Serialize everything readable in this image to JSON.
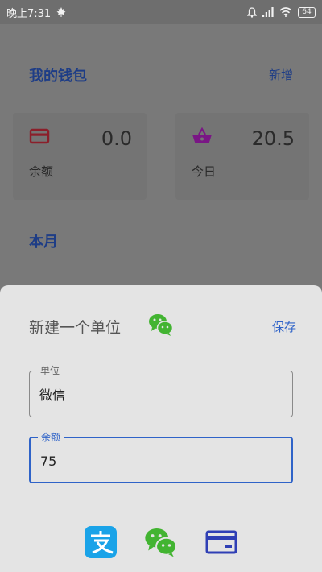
{
  "status_bar": {
    "time": "晚上7:31",
    "battery": "64"
  },
  "wallet": {
    "title": "我的钱包",
    "add_label": "新增",
    "cards": [
      {
        "value": "0.0",
        "label": "余额",
        "icon": "credit-card-icon",
        "icon_color": "#8b1f2a"
      },
      {
        "value": "20.5",
        "label": "今日",
        "icon": "basket-icon",
        "icon_color": "#7a1685"
      }
    ],
    "month_title": "本月"
  },
  "sheet": {
    "title": "新建一个单位",
    "title_icon": "wechat-icon",
    "save_label": "保存",
    "unit_field": {
      "label": "单位",
      "value": "微信"
    },
    "balance_field": {
      "label": "余额",
      "value": "75"
    },
    "options": [
      {
        "icon": "alipay-icon",
        "color": "#1aa3e8"
      },
      {
        "icon": "wechat-icon",
        "color": "#42b431"
      },
      {
        "icon": "card-icon",
        "color": "#2f3fb5"
      }
    ]
  },
  "colors": {
    "accent": "#2f63c8",
    "header_text": "#1e3d86",
    "sheet_background": "#e4e4e4"
  }
}
